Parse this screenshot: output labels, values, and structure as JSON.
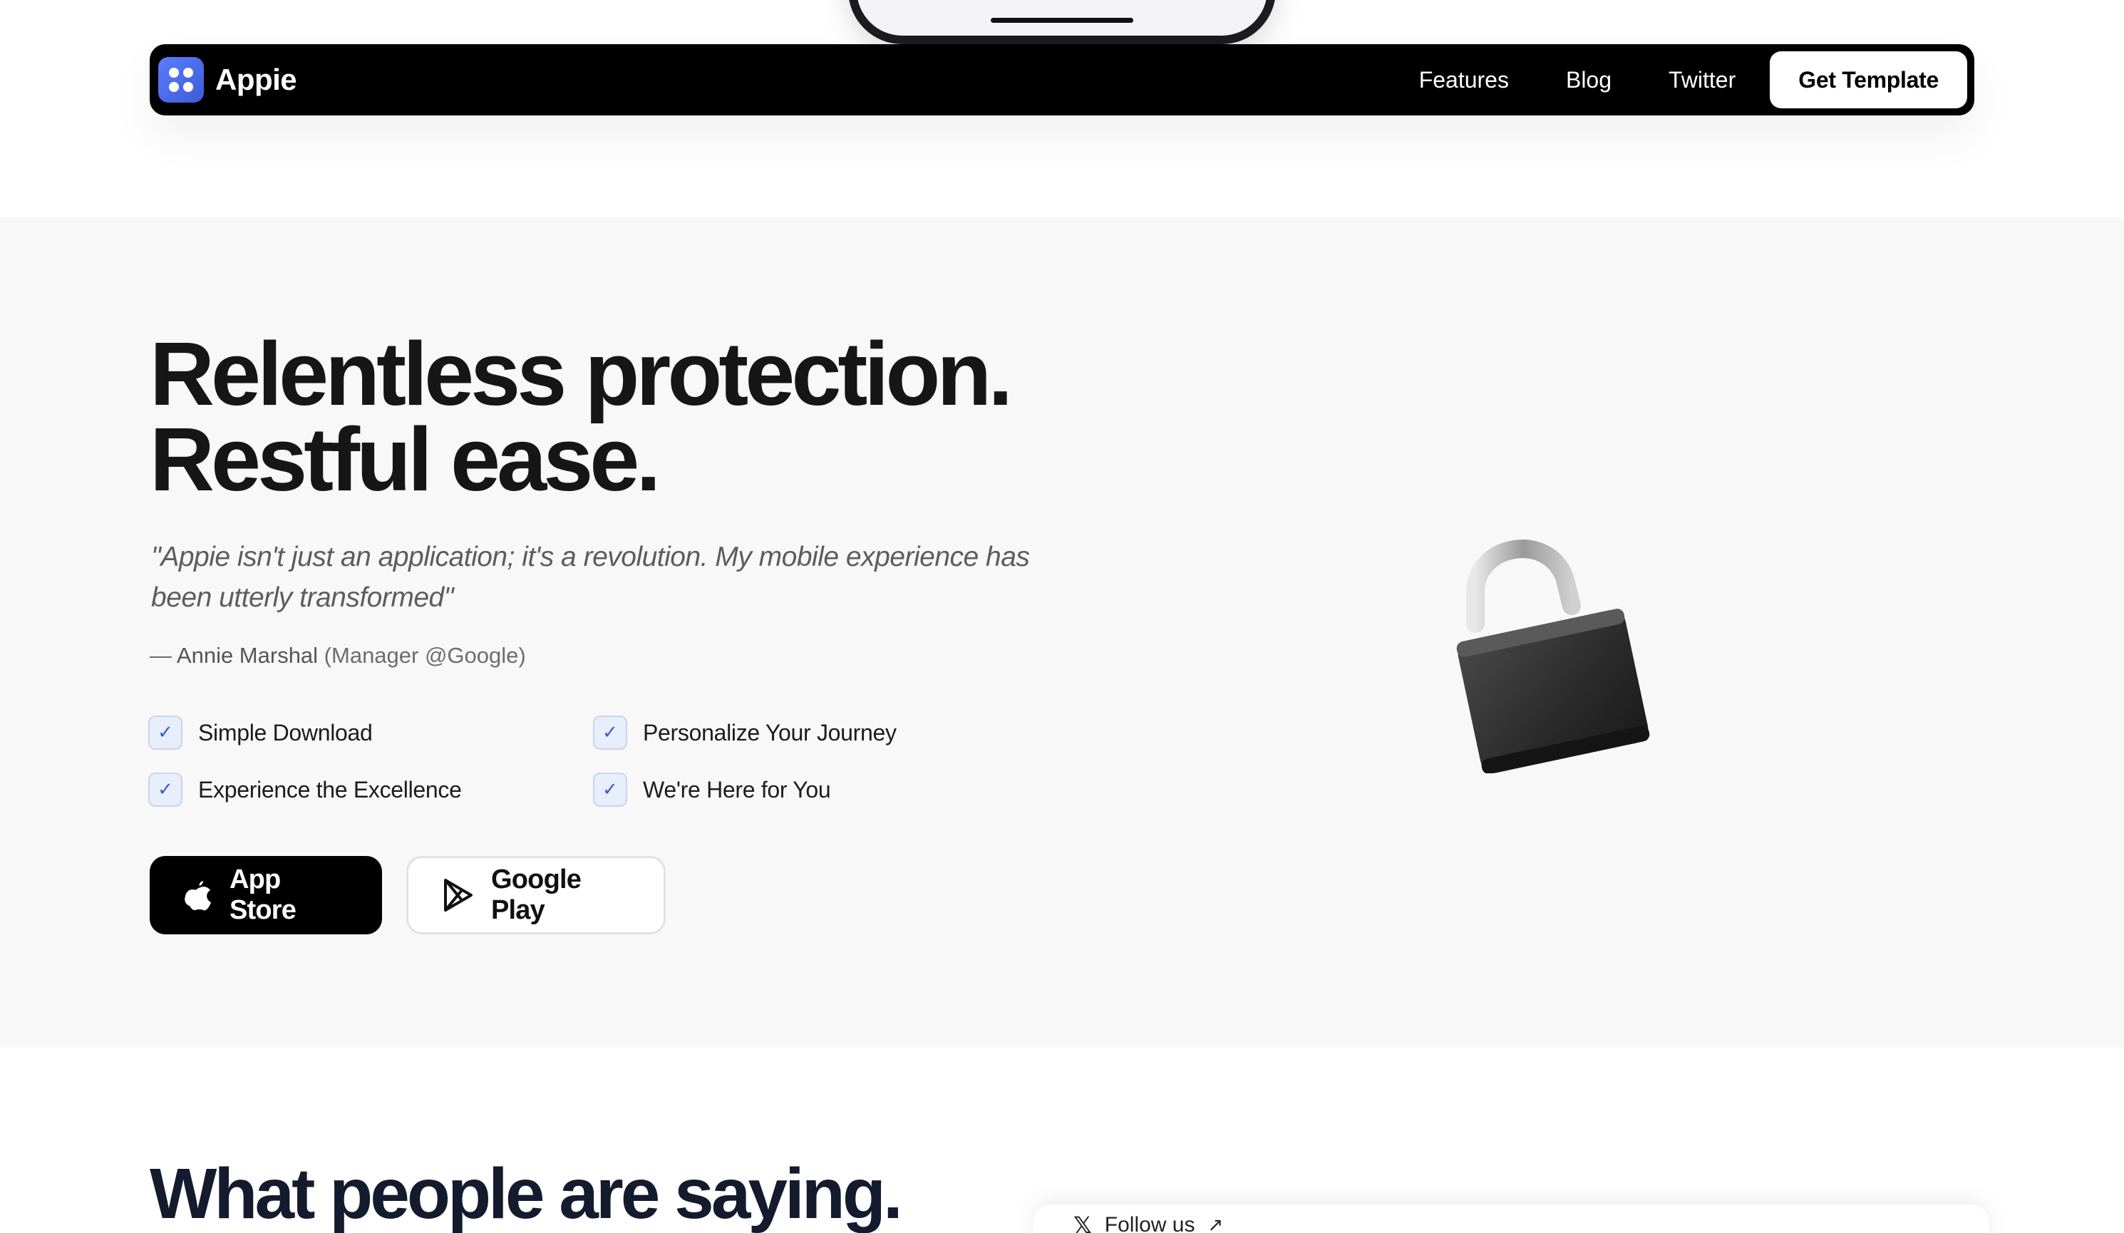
{
  "brand": {
    "name": "Appie",
    "logo_color": "#4b6cf0"
  },
  "nav": {
    "links": [
      {
        "label": "Features"
      },
      {
        "label": "Blog"
      },
      {
        "label": "Twitter"
      }
    ],
    "cta_label": "Get Template"
  },
  "hero": {
    "title_line1": "Relentless protection.",
    "title_line2": "Restful ease.",
    "quote": "\"Appie isn't just an application; it's a revolution. My mobile experience has been utterly transformed\"",
    "attribution_dash": "— ",
    "attribution_name": "Annie Marshal",
    "attribution_role": " (Manager @Google)",
    "features": [
      {
        "label": "Simple Download",
        "icon": "check-icon"
      },
      {
        "label": "Personalize Your Journey",
        "icon": "check-icon"
      },
      {
        "label": "Experience the Excellence",
        "icon": "check-icon"
      },
      {
        "label": "We're Here for You",
        "icon": "check-icon"
      }
    ],
    "buttons": {
      "app_store_label": "App Store",
      "google_play_label": "Google Play"
    },
    "illustration": "padlock-icon"
  },
  "testimonials": {
    "title": "What people are saying.",
    "follow_label": "Follow us",
    "follow_icon": "x-icon"
  },
  "colors": {
    "hero_bg": "#f8f8f8",
    "nav_bg": "#000000",
    "check_bg": "#e9eefc",
    "check_color": "#3b5bc9"
  }
}
